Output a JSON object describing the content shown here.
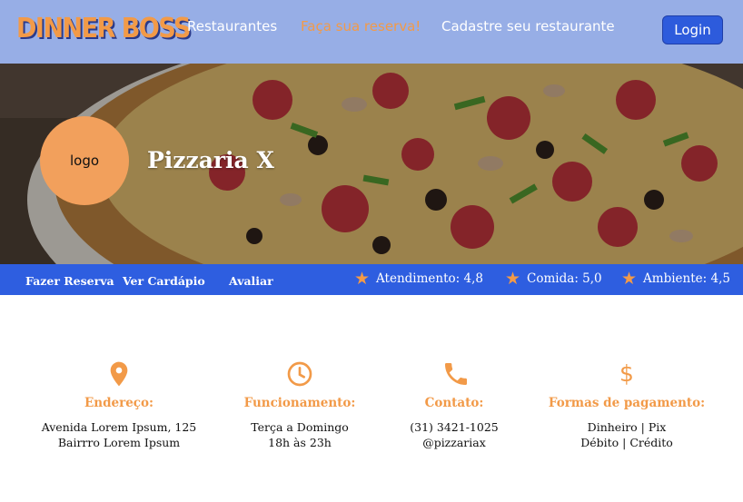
{
  "brand": {
    "name": "DINNER BOSS"
  },
  "nav": {
    "links": [
      {
        "label": "Restaurantes"
      },
      {
        "label": "Faça sua reserva!"
      },
      {
        "label": "Cadastre seu restaurante"
      }
    ],
    "login_label": "Login"
  },
  "hero": {
    "logo_text": "logo",
    "restaurant_name": "Pizzaria X"
  },
  "actions": [
    {
      "label": "Fazer Reserva"
    },
    {
      "label": "Ver Cardápio"
    },
    {
      "label": "Avaliar"
    }
  ],
  "ratings": [
    {
      "label": "Atendimento: 4,8",
      "icon": "star-icon"
    },
    {
      "label": "Comida: 5,0",
      "icon": "star-icon"
    },
    {
      "label": "Ambiente: 4,5",
      "icon": "star-icon"
    }
  ],
  "info": {
    "address": {
      "icon": "location-pin-icon",
      "title": "Endereço:",
      "lines": [
        "Avenida Lorem Ipsum, 125",
        "Bairrro Lorem Ipsum"
      ]
    },
    "hours": {
      "icon": "clock-icon",
      "title": "Funcionamento:",
      "lines": [
        "Terça a Domingo",
        "18h às 23h"
      ]
    },
    "contact": {
      "icon": "phone-icon",
      "title": "Contato:",
      "lines": [
        "(31) 3421-1025",
        "@pizzariax"
      ]
    },
    "payment": {
      "icon": "dollar-icon",
      "symbol": "$",
      "title": "Formas de pagamento:",
      "lines": [
        "Dinheiro | Pix",
        "Débito | Crédito"
      ]
    }
  },
  "colors": {
    "nav_bg": "#97aee6",
    "accent_orange": "#f29a48",
    "action_bar_bg": "#2e5ee0",
    "login_bg": "#2d5bdc"
  }
}
